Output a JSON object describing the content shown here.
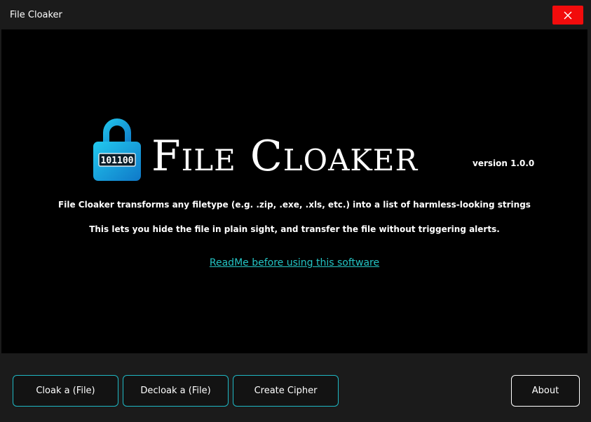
{
  "window": {
    "title": "File Cloaker",
    "close_icon": "close-icon"
  },
  "hero": {
    "lock_icon": "padlock-icon",
    "lock_code": "101100",
    "app_name": "File Cloaker",
    "version": "version 1.0.0",
    "description_1": "File Cloaker transforms any filetype (e.g. .zip, .exe, .xls, etc.) into a list of harmless-looking strings",
    "description_2": "This lets you hide the file in plain sight, and transfer the file without triggering alerts.",
    "readme_link": "ReadMe before using this software"
  },
  "footer": {
    "cloak_label": "Cloak a (File)",
    "decloak_label": "Decloak a (File)",
    "cipher_label": "Create Cipher",
    "about_label": "About"
  },
  "colors": {
    "accent": "#1fb8c4",
    "link": "#24c4c4",
    "close": "#f20c0c",
    "background": "#000000",
    "chrome": "#1b1b1b"
  }
}
